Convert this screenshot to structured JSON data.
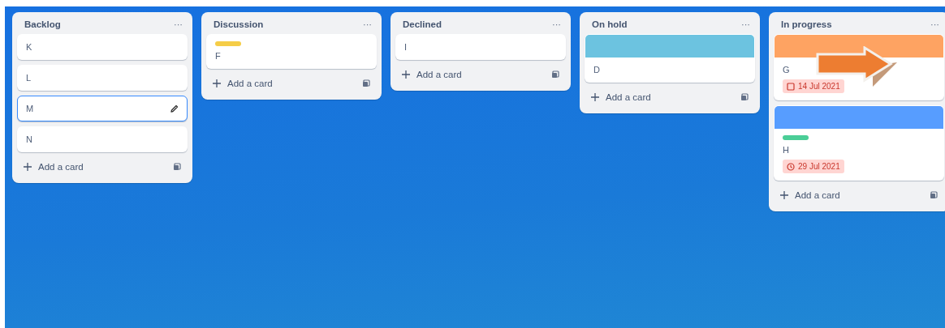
{
  "lists": [
    {
      "title": "Backlog",
      "menu": "···",
      "add_label": "Add a card",
      "cards": [
        {
          "title": "K",
          "editing": false
        },
        {
          "title": "L",
          "editing": false
        },
        {
          "title": "M",
          "editing": true
        },
        {
          "title": "N",
          "editing": false
        }
      ]
    },
    {
      "title": "Discussion",
      "menu": "···",
      "add_label": "Add a card",
      "cards": [
        {
          "title": "F",
          "editing": false,
          "label": {
            "color": "#f5cd47"
          }
        }
      ]
    },
    {
      "title": "Declined",
      "menu": "···",
      "add_label": "Add a card",
      "cards": [
        {
          "title": "I",
          "editing": false
        }
      ]
    },
    {
      "title": "On hold",
      "menu": "···",
      "add_label": "Add a card",
      "cards": [
        {
          "title": "D",
          "editing": false,
          "cover": {
            "color": "#6cc3e0"
          }
        }
      ]
    },
    {
      "title": "In progress",
      "menu": "···",
      "add_label": "Add a card",
      "annotated": true,
      "cards": [
        {
          "title": "G",
          "editing": false,
          "cover": {
            "color": "#fea362"
          },
          "due": {
            "text": "14 Jul 2021",
            "kind": "checkbox"
          }
        },
        {
          "title": "H",
          "editing": false,
          "cover": {
            "color": "#579dff"
          },
          "label": {
            "color": "#4bce97"
          },
          "due": {
            "text": "29 Jul 2021",
            "kind": "clock"
          }
        }
      ]
    }
  ]
}
